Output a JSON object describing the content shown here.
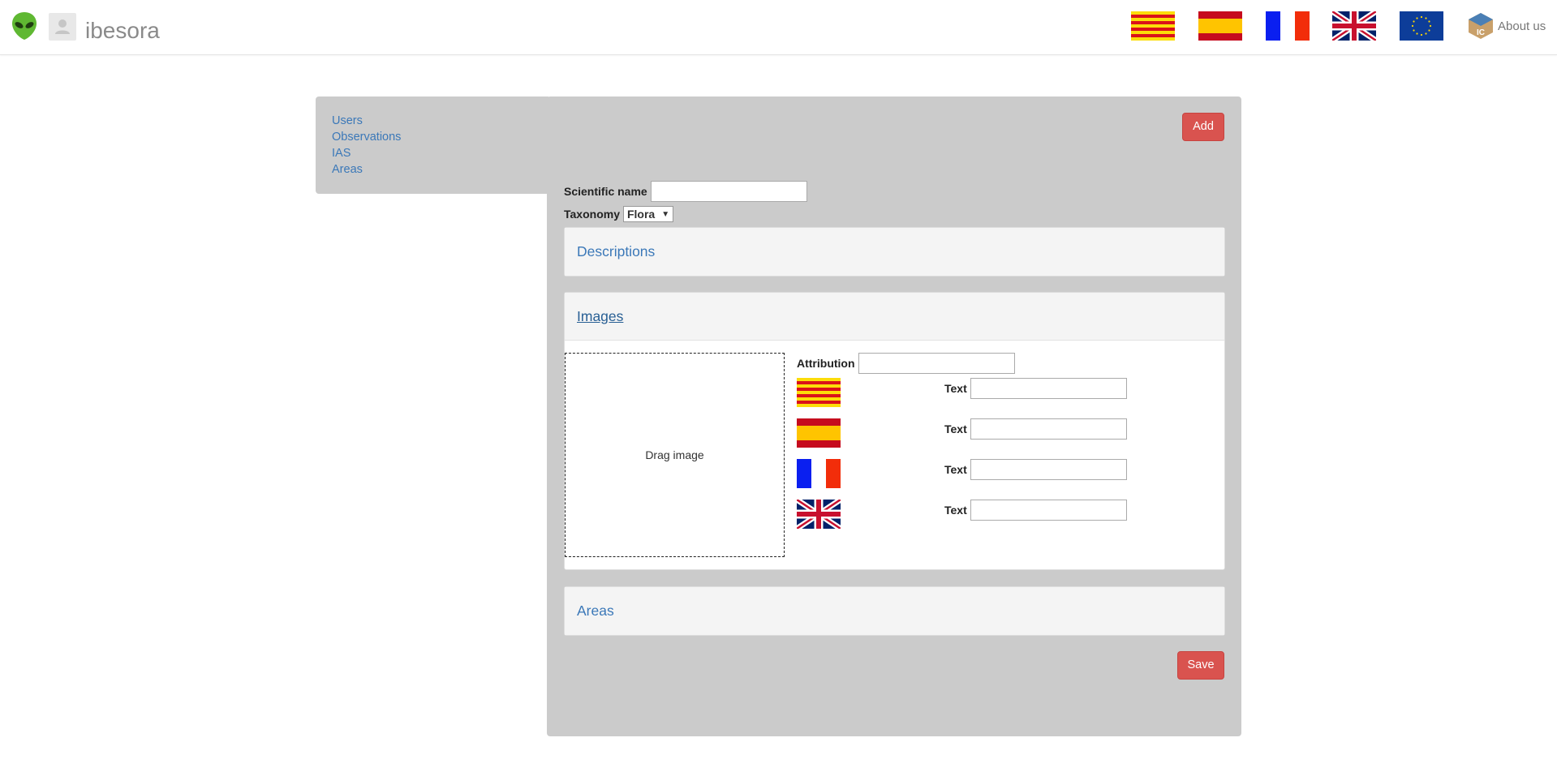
{
  "header": {
    "brand": "ibesora",
    "about_label": "About us",
    "languages": [
      "Catalan",
      "Spanish",
      "French",
      "English",
      "Europe"
    ]
  },
  "sidebar": {
    "items": [
      {
        "label": "Users"
      },
      {
        "label": "Observations"
      },
      {
        "label": "IAS"
      },
      {
        "label": "Areas"
      }
    ]
  },
  "form": {
    "add_label": "Add",
    "scientific_name_label": "Scientific name",
    "scientific_name_value": "",
    "taxonomy_label": "Taxonomy",
    "taxonomy_value": "Flora",
    "descriptions_heading": "Descriptions",
    "images_heading": "Images",
    "dropzone_text": "Drag image",
    "attribution_label": "Attribution",
    "attribution_value": "",
    "text_label": "Text",
    "text_values": [
      "",
      "",
      "",
      ""
    ],
    "areas_heading": "Areas",
    "save_label": "Save"
  },
  "colors": {
    "accent": "#d9534f",
    "link": "#3b78b8",
    "panel_bg": "#cbcbcb"
  }
}
